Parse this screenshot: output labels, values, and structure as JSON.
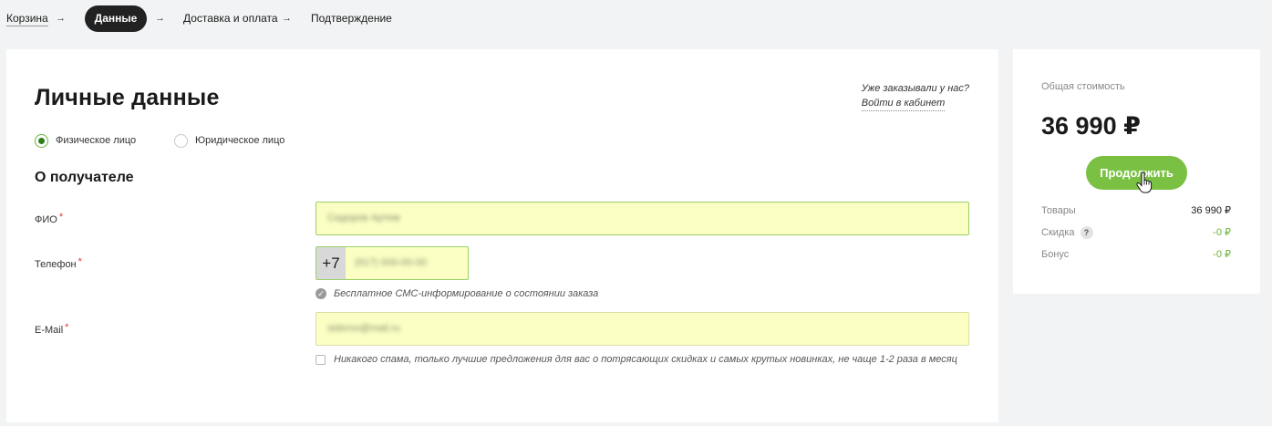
{
  "breadcrumb": {
    "steps": [
      {
        "label": "Корзина",
        "state": "done"
      },
      {
        "label": "Данные",
        "state": "active"
      },
      {
        "label": "Доставка и оплата",
        "state": "pending"
      },
      {
        "label": "Подтверждение",
        "state": "pending"
      }
    ],
    "separator": "→"
  },
  "form": {
    "title": "Личные данные",
    "login_hint": {
      "question": "Уже заказывали у нас?",
      "link": "Войти в кабинет"
    },
    "customer_type": {
      "options": [
        {
          "label": "Физическое лицо",
          "checked": true
        },
        {
          "label": "Юридическое лицо",
          "checked": false
        }
      ]
    },
    "section_title": "О получателе",
    "fields": {
      "fio": {
        "label": "ФИО",
        "required_mark": "*",
        "value": "Сидоров Артем"
      },
      "phone": {
        "label": "Телефон",
        "required_mark": "*",
        "prefix": "+7",
        "value": "(917) 000-00-00"
      },
      "email": {
        "label": "E-Mail",
        "required_mark": "*",
        "value": "sidorov@mail.ru"
      }
    },
    "sms_note": "Бесплатное СМС-информирование о состоянии заказа",
    "spam_note": "Никакого спама, только лучшие предложения для вас о потрясающих скидках и самых крутых новинках, не чаще 1-2 раза в месяц",
    "spam_checked": false
  },
  "summary": {
    "total_label": "Общая стоимость",
    "total_value": "36 990 ₽",
    "continue_label": "Продолжить",
    "rows": [
      {
        "label": "Товары",
        "value": "36 990 ₽"
      },
      {
        "label": "Скидка",
        "value": "-0 ₽",
        "help": "?"
      },
      {
        "label": "Бонус",
        "value": "-0 ₽"
      }
    ]
  },
  "colors": {
    "accent_green": "#7ac143",
    "input_fill": "#fbffc4",
    "active_step_bg": "#222222",
    "required_red": "#e53935"
  },
  "icons": {
    "separator": "arrow-right-icon",
    "sms_note": "check-circle-icon",
    "discount_help": "question-icon",
    "cursor": "hand-pointer-icon"
  }
}
